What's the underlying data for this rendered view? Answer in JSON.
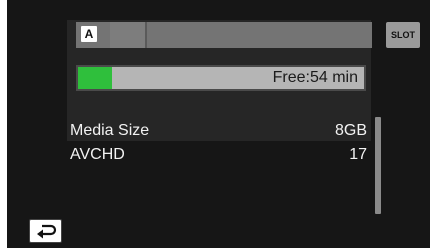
{
  "colors": {
    "panel": "#161616",
    "card": "#262626",
    "strip": "#747474",
    "bar_bg": "#b5b5b5",
    "bar_fill": "#2fbf3c",
    "slot_button": "#9a9a9a",
    "text_light": "#f2f2f2"
  },
  "top": {
    "slot_icon_label": "A",
    "slot_button_label": "SLOT"
  },
  "capacity": {
    "free_text": "Free:54 min",
    "used_fraction": 0.12
  },
  "info_rows": [
    {
      "label": "Media Size",
      "value": "8GB"
    },
    {
      "label": "AVCHD",
      "value": "17"
    }
  ],
  "footer": {
    "back_icon": "return-arrow-icon"
  }
}
